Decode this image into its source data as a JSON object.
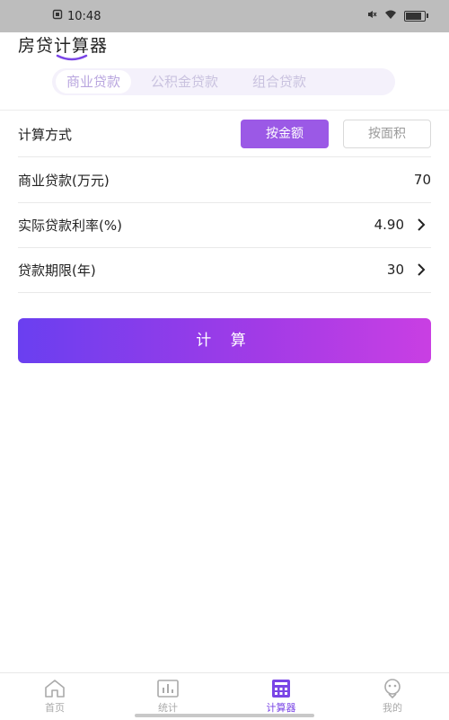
{
  "status_bar": {
    "time": "10:48",
    "battery_level": 0.85
  },
  "header": {
    "title": "房贷计算器"
  },
  "loan_tabs": [
    {
      "label": "商业贷款",
      "active": true
    },
    {
      "label": "公积金贷款",
      "active": false
    },
    {
      "label": "组合贷款",
      "active": false
    }
  ],
  "form": {
    "method": {
      "label": "计算方式",
      "options": [
        {
          "label": "按金额",
          "selected": true
        },
        {
          "label": "按面积",
          "selected": false
        }
      ]
    },
    "commercial_loan": {
      "label": "商业贷款(万元)",
      "value": "70"
    },
    "interest_rate": {
      "label": "实际贷款利率(%)",
      "value": "4.90"
    },
    "loan_term": {
      "label": "贷款期限(年)",
      "value": "30"
    }
  },
  "calculate_button": {
    "label": "计 算"
  },
  "bottom_nav": [
    {
      "label": "首页",
      "icon": "home-icon",
      "active": false
    },
    {
      "label": "统计",
      "icon": "chart-icon",
      "active": false
    },
    {
      "label": "计算器",
      "icon": "calculator-icon",
      "active": true
    },
    {
      "label": "我的",
      "icon": "profile-icon",
      "active": false
    }
  ],
  "colors": {
    "accent": "#9b59e6",
    "gradient_start": "#6a3ff0",
    "gradient_end": "#c93fe3",
    "status_bar_bg": "#bdbdbd"
  }
}
